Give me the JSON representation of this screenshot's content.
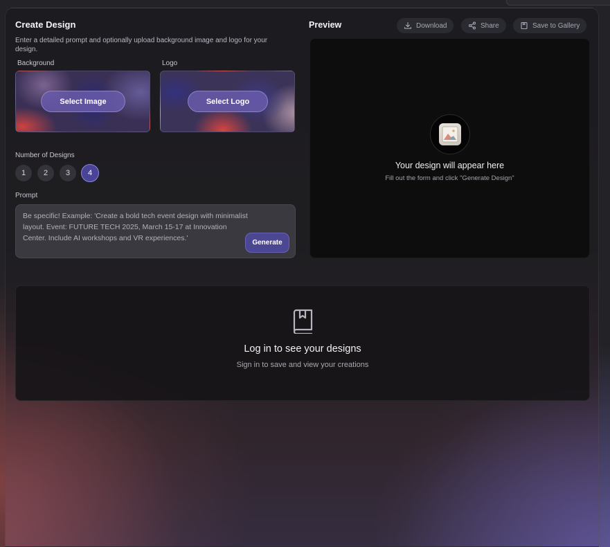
{
  "form": {
    "title": "Create Design",
    "subtitle": "Enter a detailed prompt and optionally upload background image and logo for your design.",
    "background_label": "Background",
    "logo_label": "Logo",
    "select_image_label": "Select Image",
    "select_logo_label": "Select Logo",
    "number_label": "Number of Designs",
    "number_options": [
      "1",
      "2",
      "3",
      "4"
    ],
    "selected_number": "4",
    "prompt_label": "Prompt",
    "prompt_placeholder": "Be specific! Example: 'Create a bold tech event design with minimalist layout. Event: FUTURE TECH 2025, March 15-17 at Innovation Center. Include AI workshops and VR experiences.'",
    "generate_label": "Generate"
  },
  "preview": {
    "title": "Preview",
    "download_label": "Download",
    "share_label": "Share",
    "save_label": "Save to Gallery",
    "empty_heading": "Your design will appear here",
    "empty_sub": "Fill out the form and click \"Generate Design\""
  },
  "gallery": {
    "heading": "Log in to see your designs",
    "sub": "Sign in to save and view your creations"
  },
  "colors": {
    "accent": "#4c4793",
    "accent_border": "#8d86e6"
  },
  "icons": {
    "download": "download-icon",
    "share": "share-icon",
    "save": "bookmark-icon",
    "preview": "image-placeholder-icon",
    "gallery": "book-bookmark-icon"
  }
}
